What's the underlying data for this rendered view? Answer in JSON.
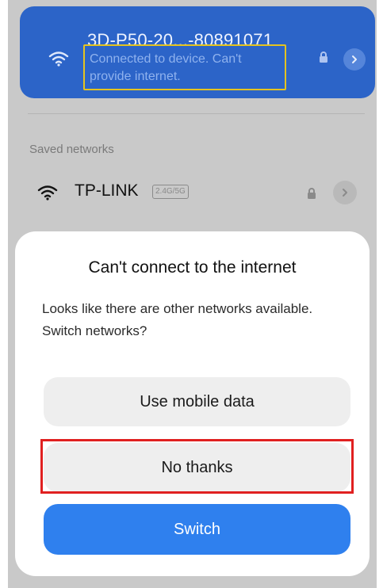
{
  "connected_network": {
    "name": "3D-P50-20...-80891071",
    "status": "Connected to device. Can't provide internet."
  },
  "saved_networks": {
    "title": "Saved networks",
    "items": [
      {
        "name": "TP-LINK",
        "band": "2.4G/5G"
      }
    ]
  },
  "dialog": {
    "title": "Can't connect to the internet",
    "message": "Looks like there are other networks available. Switch networks?",
    "buttons": {
      "mobile_data": "Use mobile data",
      "no_thanks": "No thanks",
      "switch": "Switch"
    }
  },
  "colors": {
    "connected_card": "#2c64c8",
    "status_highlight": "#e4c320",
    "button_highlight": "#e02020",
    "switch_button": "#2f80ee"
  },
  "icons": [
    "wifi-icon",
    "lock-icon",
    "chevron-right-icon"
  ]
}
